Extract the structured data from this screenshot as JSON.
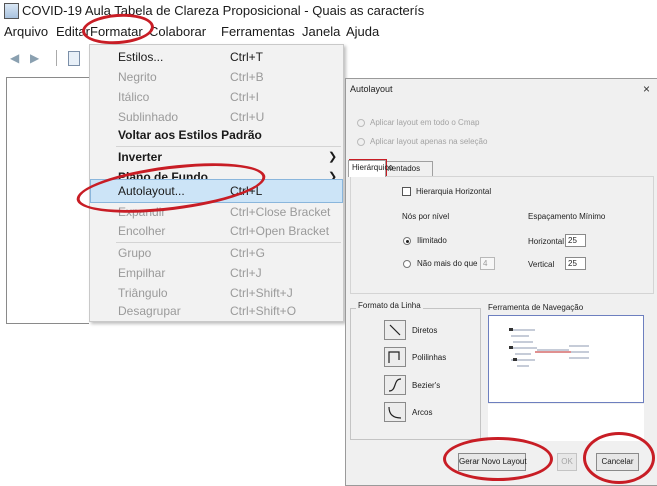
{
  "window": {
    "title": "COVID-19 Aula Tabela de Clareza Proposicional - Quais as caracterís"
  },
  "menubar": {
    "items": [
      "Arquivo",
      "Editar",
      "Formatar",
      "Colaborar",
      "Ferramentas",
      "Janela",
      "Ajuda"
    ],
    "active": "Formatar"
  },
  "toolbar": {
    "back_icon": "back-arrow-icon",
    "forward_icon": "forward-arrow-icon",
    "document_icon": "document-icon"
  },
  "format_menu": {
    "items": [
      {
        "label": "Estilos...",
        "shortcut": "Ctrl+T",
        "state": "enabled"
      },
      {
        "label": "Negrito",
        "shortcut": "Ctrl+B",
        "state": "disabled"
      },
      {
        "label": "Itálico",
        "shortcut": "Ctrl+I",
        "state": "disabled"
      },
      {
        "label": "Sublinhado",
        "shortcut": "Ctrl+U",
        "state": "disabled"
      },
      {
        "label": "Voltar aos Estilos Padrão",
        "shortcut": "",
        "state": "bold"
      },
      {
        "label": "Inverter",
        "shortcut": "",
        "state": "submenu"
      },
      {
        "label": "Plano de Fundo",
        "shortcut": "",
        "state": "submenu"
      },
      {
        "label": "Autolayout...",
        "shortcut": "Ctrl+L",
        "state": "highlighted"
      },
      {
        "label": "Expandir",
        "shortcut": "Ctrl+Close Bracket",
        "state": "disabled"
      },
      {
        "label": "Encolher",
        "shortcut": "Ctrl+Open Bracket",
        "state": "disabled"
      },
      {
        "label": "Grupo",
        "shortcut": "Ctrl+G",
        "state": "disabled"
      },
      {
        "label": "Empilhar",
        "shortcut": "Ctrl+J",
        "state": "disabled"
      },
      {
        "label": "Triângulo",
        "shortcut": "Ctrl+Shift+J",
        "state": "disabled"
      },
      {
        "label": "Desagrupar",
        "shortcut": "Ctrl+Shift+O",
        "state": "disabled"
      }
    ]
  },
  "dialog": {
    "title": "Autolayout",
    "close_glyph": "×",
    "scope": {
      "option_all": "Aplicar layout em todo o Cmap",
      "option_selection": "Aplicar layout apenas na seleção"
    },
    "tabs": [
      "Hierárquico",
      "Orientados"
    ],
    "active_tab": "Hierárquico",
    "hierarchy_horizontal_label": "Hierarquia Horizontal",
    "hierarchy_horizontal_checked": false,
    "nodes_per_level": {
      "heading": "Nós por nível",
      "unlimited_label": "Ilimitado",
      "max_label": "Não mais do que",
      "max_value": "4",
      "selected": "Ilimitado"
    },
    "min_spacing": {
      "heading": "Espaçamento Mínimo",
      "horizontal_label": "Horizontal",
      "horizontal_value": "25",
      "vertical_label": "Vertical",
      "vertical_value": "25"
    },
    "line_format": {
      "heading": "Formato da Linha",
      "options": [
        {
          "label": "Diretos",
          "icon": "straight-line-icon"
        },
        {
          "label": "Polilinhas",
          "icon": "polyline-icon"
        },
        {
          "label": "Bezier's",
          "icon": "bezier-curve-icon"
        },
        {
          "label": "Arcos",
          "icon": "arc-line-icon"
        }
      ]
    },
    "navigation": {
      "heading": "Ferramenta de Navegação"
    },
    "buttons": {
      "generate": "Gerar Novo Layout",
      "ok": "OK",
      "cancel": "Cancelar"
    }
  },
  "colors": {
    "annotation_red": "#c81d25",
    "menu_highlight": "#cce4f7",
    "preview_border": "#6d7fbf"
  }
}
